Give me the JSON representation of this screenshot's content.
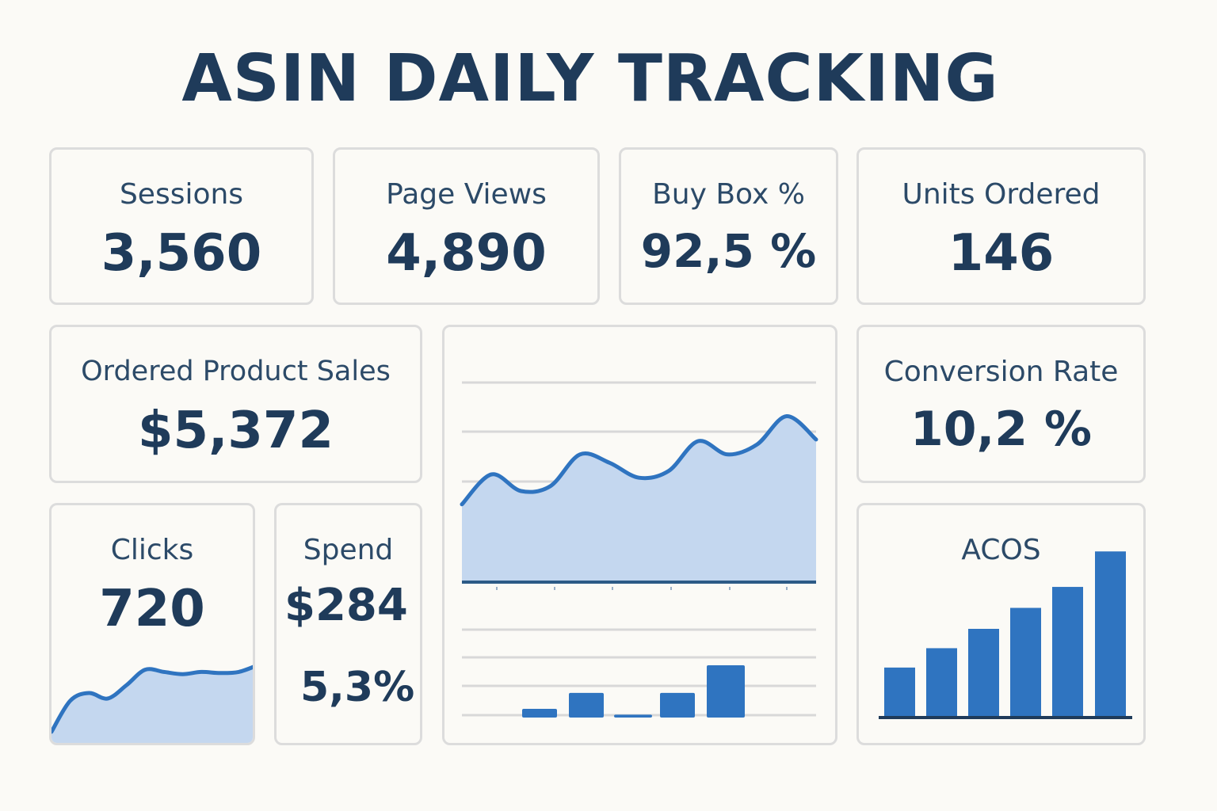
{
  "page": {
    "title": "ASIN DAILY TRACKING"
  },
  "metrics": {
    "sessions": {
      "label": "Sessions",
      "value": "3,560"
    },
    "page_views": {
      "label": "Page Views",
      "value": "4,890"
    },
    "buy_box": {
      "label": "Buy Box %",
      "value": "92,5 %"
    },
    "units_ordered": {
      "label": "Units Ordered",
      "value": "146"
    },
    "ordered_product_sales": {
      "label": "Ordered Product Sales",
      "value": "$5,372"
    },
    "conversion_rate": {
      "label": "Conversion Rate",
      "value": "10,2 %"
    },
    "clicks": {
      "label": "Clicks",
      "value": "720"
    },
    "spend": {
      "label": "Spend",
      "value": "$284",
      "secondary": "5,3%"
    },
    "acos": {
      "label": "ACOS"
    }
  },
  "colors": {
    "primary": "#1f3b5a",
    "accent": "#2f74c0",
    "fill": "#c4d7ef",
    "border": "#dcdcdc",
    "background": "#fbfaf6"
  },
  "chart_data": [
    {
      "type": "area",
      "name": "clicks-sparkline",
      "values": [
        10,
        38,
        45,
        40,
        52,
        66,
        64,
        62,
        64,
        63,
        64,
        70
      ],
      "ylim": [
        0,
        100
      ]
    },
    {
      "type": "area",
      "name": "main-trend",
      "values": [
        22,
        40,
        30,
        33,
        52,
        47,
        38,
        42,
        60,
        52,
        58,
        75,
        61
      ],
      "ylim": [
        0,
        100
      ],
      "grid": true
    },
    {
      "type": "bar",
      "name": "main-bars",
      "values": [
        3,
        8.5,
        1,
        8.5,
        18
      ],
      "ylim": [
        0,
        30
      ],
      "grid": true
    },
    {
      "type": "bar",
      "name": "acos-bars",
      "values": [
        31,
        43,
        55,
        68,
        81,
        103
      ],
      "ylim": [
        0,
        110
      ]
    }
  ]
}
